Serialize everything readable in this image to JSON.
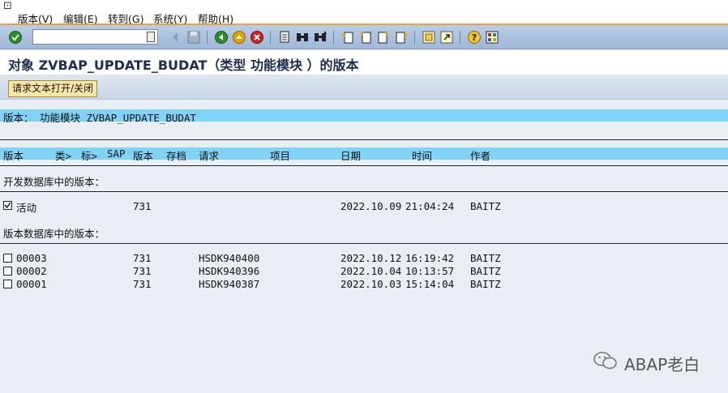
{
  "menu": {
    "items": [
      "版本(V)",
      "编辑(E)",
      "转到(G)",
      "系统(Y)",
      "帮助(H)"
    ]
  },
  "toolbar": {
    "command_value": "",
    "icons": [
      "enter-icon",
      "back-icon",
      "save-icon",
      "back-green-icon",
      "exit-icon",
      "cancel-icon",
      "print-icon",
      "find-icon",
      "find-next-icon",
      "first-page-icon",
      "prev-page-icon",
      "next-page-icon",
      "last-page-icon",
      "new-session-icon",
      "shortcut-icon",
      "help-icon",
      "layout-icon"
    ]
  },
  "title": "对象 ZVBAP_UPDATE_BUDAT（类型 功能模块 ）的版本",
  "app_button": "请求文本打开/关闭",
  "version_header": "版本：  功能模块  ZVBAP_UPDATE_BUDAT",
  "columns": {
    "version": "版本",
    "type": "类>",
    "mark": "标>",
    "sap": "SAP",
    "release": "版本",
    "archive": "存档",
    "request": "请求",
    "item": "项目",
    "date": "日期",
    "time": "时间",
    "author": "作者"
  },
  "dev_section_label": "开发数据库中的版本：",
  "active_row": {
    "label": "活动",
    "release": "731",
    "date": "2022.10.09",
    "time": "21:04:24",
    "author": "BAITZ"
  },
  "ver_section_label": "版本数据库中的版本：",
  "rows": [
    {
      "version": "00003",
      "release": "731",
      "request": "HSDK940400",
      "date": "2022.10.12",
      "time": "16:19:42",
      "author": "BAITZ"
    },
    {
      "version": "00002",
      "release": "731",
      "request": "HSDK940396",
      "date": "2022.10.04",
      "time": "10:13:57",
      "author": "BAITZ"
    },
    {
      "version": "00001",
      "release": "731",
      "request": "HSDK940387",
      "date": "2022.10.03",
      "time": "15:14:04",
      "author": "BAITZ"
    }
  ],
  "watermark": "ABAP老白"
}
